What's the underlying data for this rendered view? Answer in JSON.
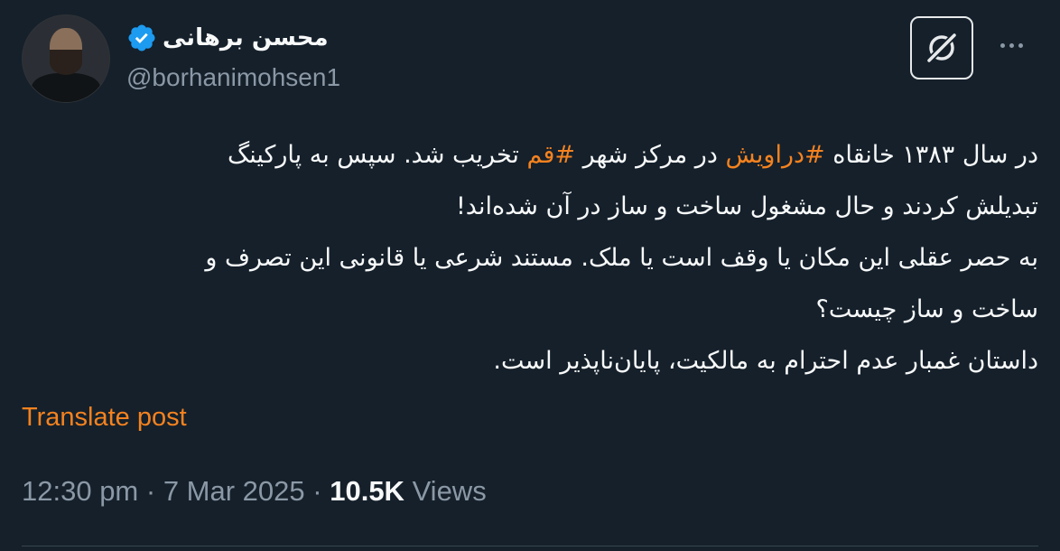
{
  "author": {
    "display_name": "محسن برهانی",
    "handle": "@borhanimohsen1",
    "verified_color": "#1d9bf0"
  },
  "actions": {
    "grok_icon": "grok-icon",
    "more_icon": "more-horizontal-icon"
  },
  "tweet": {
    "line1_pre": "در سال ۱۳۸۳ خانقاه ",
    "hashtag1": "#دراویش",
    "line1_mid": " در مرکز شهر ",
    "hashtag2": "#قم",
    "line1_post": " تخریب شد. سپس به پارکینگ",
    "line2": "تبدیلش کردند و حال مشغول ساخت و ساز در آن شده‌اند!",
    "line3": "به حصر عقلی این مکان یا وقف است یا ملک. مستند شرعی یا قانونی این تصرف و",
    "line4": "ساخت و ساز چیست؟",
    "line5": "داستان غمبار عدم احترام به مالکیت، پایان‌ناپذیر است."
  },
  "translate_label": "Translate post",
  "meta": {
    "time": "12:30 pm",
    "sep1": " · ",
    "date": "7 Mar 2025",
    "sep2": " · ",
    "views_count": "10.5K",
    "views_label": " Views"
  },
  "colors": {
    "background": "#15202b",
    "accent": "#f4821f",
    "secondary_text": "#8b98a5"
  }
}
